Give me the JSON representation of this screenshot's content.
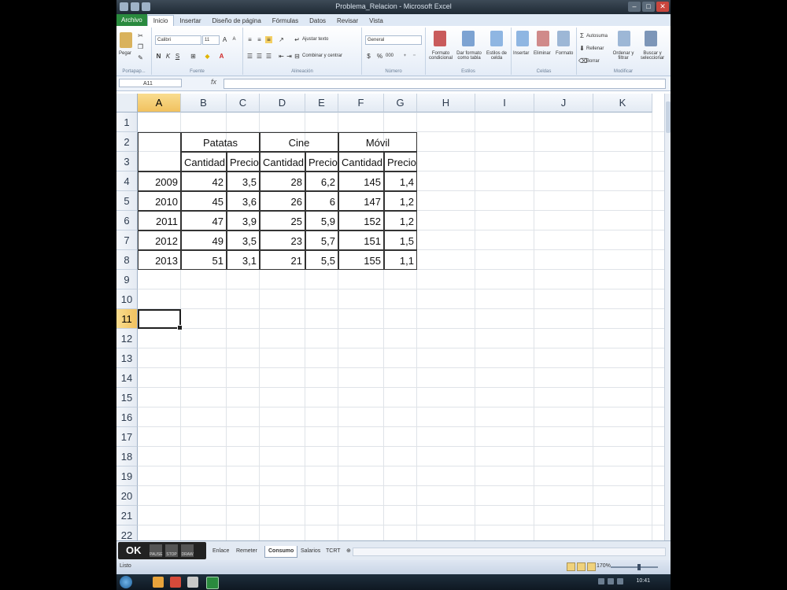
{
  "window": {
    "title": "Problema_Relacion - Microsoft Excel"
  },
  "ribbon": {
    "tabs": [
      "Archivo",
      "Inicio",
      "Insertar",
      "Diseño de página",
      "Fórmulas",
      "Datos",
      "Revisar",
      "Vista"
    ],
    "active_tab": "Inicio",
    "clipboard": {
      "paste_label": "Pegar",
      "group_label": "Portapap..."
    },
    "font": {
      "font_name": "Calibri",
      "font_size": "11",
      "bold": "N",
      "italic": "K",
      "underline": "S",
      "group_label": "Fuente"
    },
    "alignment": {
      "wrap_label": "Ajustar texto",
      "merge_label": "Combinar y centrar",
      "group_label": "Alineación"
    },
    "number": {
      "format": "General",
      "percent": "%",
      "thousands": "000",
      "group_label": "Número"
    },
    "styles": {
      "cond_format": "Formato condicional",
      "as_table": "Dar formato como tabla",
      "cell_styles": "Estilos de celda",
      "group_label": "Estilos"
    },
    "cells": {
      "insert": "Insertar",
      "delete": "Eliminar",
      "format": "Formato",
      "group_label": "Celdas"
    },
    "editing": {
      "autosum": "Autosuma",
      "fill": "Rellenar",
      "clear": "Borrar",
      "sort_filter": "Ordenar y filtrar",
      "find_select": "Buscar y seleccionar",
      "group_label": "Modificar"
    }
  },
  "formula_bar": {
    "name_box": "A11",
    "fx": "fx",
    "content": ""
  },
  "grid": {
    "columns": [
      "A",
      "B",
      "C",
      "D",
      "E",
      "F",
      "G",
      "H",
      "I",
      "J",
      "K"
    ],
    "rows": [
      "1",
      "2",
      "3",
      "4",
      "5",
      "6",
      "7",
      "8",
      "9",
      "10",
      "11",
      "12",
      "13",
      "14",
      "15",
      "16",
      "17",
      "18",
      "19",
      "20",
      "21",
      "22"
    ],
    "selected_cell": "A11"
  },
  "table": {
    "groups": [
      "Patatas",
      "Cine",
      "Móvil"
    ],
    "subheaders": [
      "Cantidad",
      "Precio",
      "Cantidad",
      "Precio",
      "Cantidad",
      "Precio"
    ],
    "rows": [
      {
        "year": "2009",
        "values": [
          "42",
          "3,5",
          "28",
          "6,2",
          "145",
          "1,4"
        ]
      },
      {
        "year": "2010",
        "values": [
          "45",
          "3,6",
          "26",
          "6",
          "147",
          "1,2"
        ]
      },
      {
        "year": "2011",
        "values": [
          "47",
          "3,9",
          "25",
          "5,9",
          "152",
          "1,2"
        ]
      },
      {
        "year": "2012",
        "values": [
          "49",
          "3,5",
          "23",
          "5,7",
          "151",
          "1,5"
        ]
      },
      {
        "year": "2013",
        "values": [
          "51",
          "3,1",
          "21",
          "5,5",
          "155",
          "1,1"
        ]
      }
    ]
  },
  "sheet_tabs": [
    "Enlace",
    "Remeter",
    "Consumo",
    "Salarios",
    "TCRT"
  ],
  "active_sheet": "Consumo",
  "overlay": {
    "ok_text": "OK",
    "btn1": "PAUSE",
    "btn2": "STOP",
    "btn3": "DRAW"
  },
  "status": {
    "ready": "Listo",
    "zoom": "170%"
  },
  "taskbar": {
    "clock": "10:41"
  }
}
